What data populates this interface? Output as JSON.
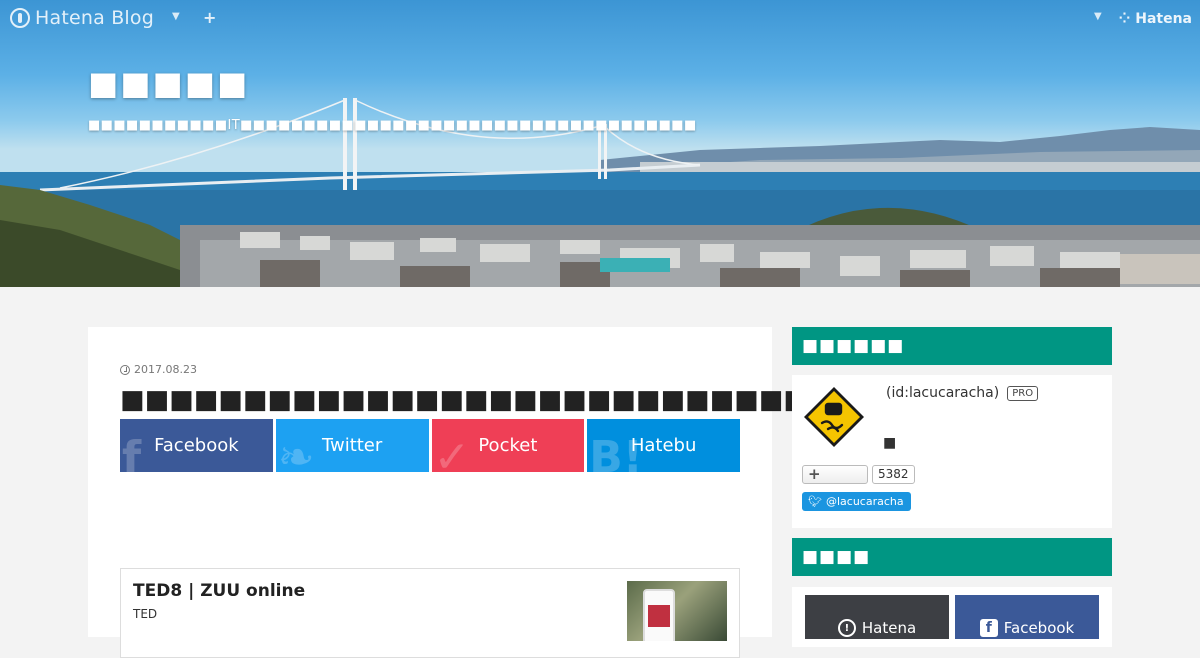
{
  "topbar": {
    "logo_text": "Hatena Blog",
    "logo_icon": "hatena-blog-icon",
    "dropdown_icon": "caret-down-icon",
    "add_icon": "plus-icon",
    "right_brand": "Hatena"
  },
  "header": {
    "title": "■■■■■",
    "description": "■■■■■■■■■■■IT■■■■■■■■■■■■■■■■■■■■■■■■■■■■■■■■■■■■"
  },
  "entry": {
    "date": "2017.08.23",
    "title": "■■■■■■■■■■■■■■■■■■■■■■■■■■■■■■■"
  },
  "share": [
    {
      "label": "Facebook",
      "icon": "facebook-icon",
      "color": "#3b5998"
    },
    {
      "label": "Twitter",
      "icon": "twitter-icon",
      "color": "#1da1f2"
    },
    {
      "label": "Pocket",
      "icon": "pocket-icon",
      "color": "#ef3f56"
    },
    {
      "label": "Hatebu",
      "icon": "hatebu-icon",
      "color": "#008fde"
    }
  ],
  "embed": {
    "title": "TED8 | ZUU online",
    "subtitle": "TED"
  },
  "sidebar": {
    "profile_heading": "■■■■■■",
    "profile_id": "(id:lacucaracha)",
    "pro_badge": "PRO",
    "profile_note": "■",
    "follow_label": "+",
    "follow_count": "5382",
    "twitter_handle": "@lacucaracha",
    "subscribe_heading": "■■■■",
    "subscribe_hatena": "Hatena",
    "subscribe_facebook": "Facebook"
  },
  "colors": {
    "accent": "#009683",
    "facebook": "#3b5998",
    "twitter": "#1da1f2",
    "pocket": "#ef3f56",
    "hatebu": "#008fde"
  }
}
